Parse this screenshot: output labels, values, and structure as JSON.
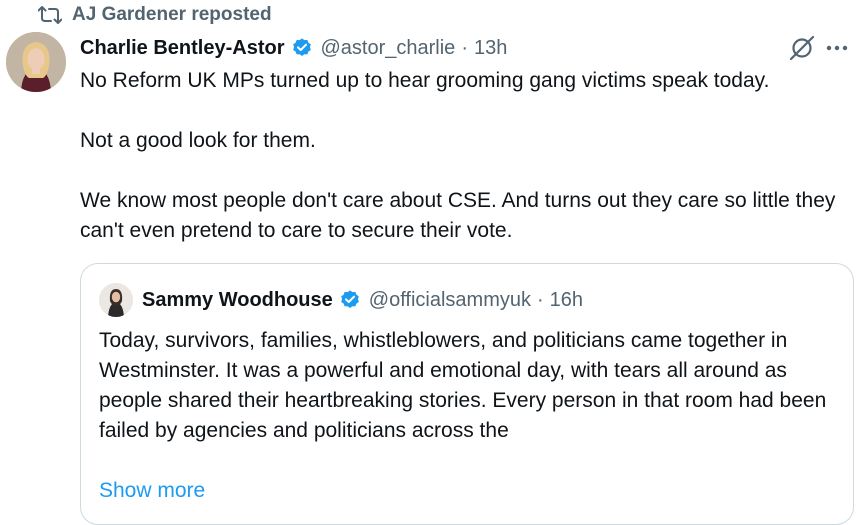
{
  "repost": {
    "text": "AJ Gardener reposted"
  },
  "post": {
    "author_name": "Charlie Bentley-Astor",
    "handle": "@astor_charlie",
    "separator": "·",
    "time": "13h",
    "paragraphs": [
      "No Reform UK MPs turned up to hear grooming gang victims speak today.",
      "Not a good look for them.",
      "We know most people don't care about CSE. And turns out they care so little they can't even pretend to care to secure their vote."
    ]
  },
  "quote": {
    "author_name": "Sammy Woodhouse",
    "handle": "@officialsammyuk",
    "separator": "·",
    "time": "16h",
    "text": "Today, survivors, families, whistleblowers, and politicians came together in Westminster. It was a powerful and emotional day, with tears all around as people shared their heartbreaking stories. Every person in that room had been failed by agencies and politicians across the",
    "show_more": "Show more"
  },
  "colors": {
    "verified": "#1d9bf0",
    "secondary_text": "#536471",
    "link": "#1d9bf0",
    "border": "#cfd9de"
  },
  "icons": [
    "repost-icon",
    "verified-badge-icon",
    "grok-icon",
    "more-options-icon"
  ]
}
